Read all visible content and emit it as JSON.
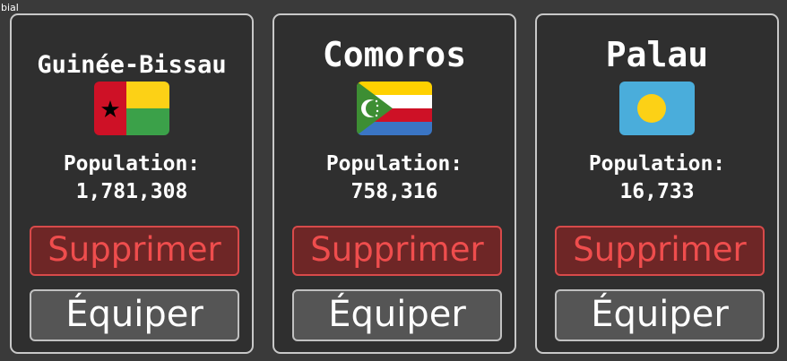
{
  "header": {
    "label": "bial"
  },
  "colors": {
    "delete_text": "#ef4d4d",
    "delete_bg": "#6e2626",
    "equip_bg": "#555555",
    "card_border": "#c8c8c8"
  },
  "cards": [
    {
      "country": "Guinée-Bissau",
      "flag": "flag-guinea-bissau-icon",
      "population_label": "Population:",
      "population": "1,781,308",
      "delete_label": "Supprimer",
      "equip_label": "Équiper"
    },
    {
      "country": "Comoros",
      "flag": "flag-comoros-icon",
      "population_label": "Population:",
      "population": "758,316",
      "delete_label": "Supprimer",
      "equip_label": "Équiper"
    },
    {
      "country": "Palau",
      "flag": "flag-palau-icon",
      "population_label": "Population:",
      "population": "16,733",
      "delete_label": "Supprimer",
      "equip_label": "Équiper"
    }
  ]
}
